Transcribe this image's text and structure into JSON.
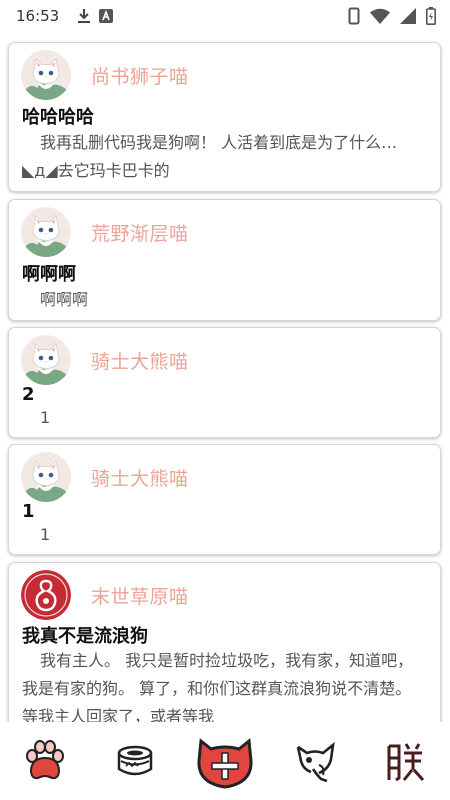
{
  "status": {
    "time": "16:53"
  },
  "posts": [
    {
      "username": "尚书狮子喵",
      "avatar": "kitten-avatar",
      "title": "哈哈哈哈",
      "content": "我再乱删代码我是狗啊！ 人活着到底是为了什么…◣д◢去它玛卡巴卡的"
    },
    {
      "username": "荒野渐层喵",
      "avatar": "kitten-avatar",
      "title": "啊啊啊",
      "content": "啊啊啊"
    },
    {
      "username": "骑士大熊喵",
      "avatar": "kitten-avatar",
      "title": "2",
      "content": "1"
    },
    {
      "username": "骑士大熊喵",
      "avatar": "kitten-avatar",
      "title": "1",
      "content": "1"
    },
    {
      "username": "末世草原喵",
      "avatar": "red-gourd-avatar",
      "title": "我真不是流浪狗",
      "content": "我有主人。 我只是暂时捡垃圾吃，我有家，知道吧，我是有家的狗。 算了，和你们这群真流浪狗说不清楚。 等我主人回家了，或者等我"
    }
  ],
  "nav": [
    {
      "icon": "paw-icon"
    },
    {
      "icon": "cat-food-can-icon"
    },
    {
      "icon": "add-post-icon"
    },
    {
      "icon": "cat-mask-icon"
    },
    {
      "icon": "zhen-glyph-icon"
    }
  ],
  "colors": {
    "username": "#eba596",
    "accent": "#e0463f"
  }
}
